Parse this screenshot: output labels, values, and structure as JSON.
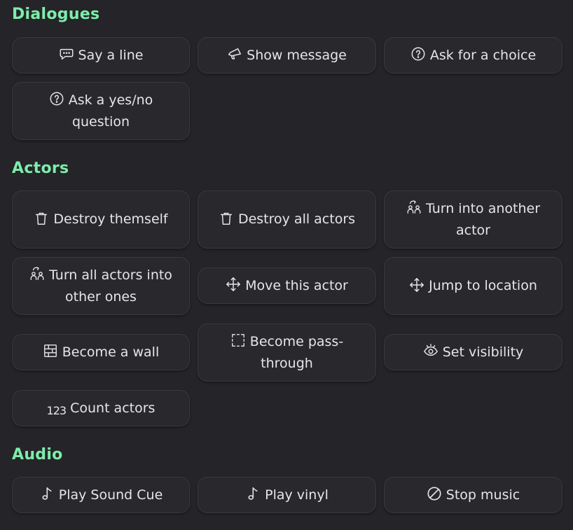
{
  "sections": {
    "dialogues": {
      "title": "Dialogues",
      "buttons": {
        "say_line": "Say a line",
        "show_message": "Show message",
        "ask_choice": "Ask for a choice",
        "ask_yes_no": "Ask a yes/no question"
      }
    },
    "actors": {
      "title": "Actors",
      "buttons": {
        "destroy_themself": "Destroy themself",
        "destroy_all_actors": "Destroy all actors",
        "turn_into_another": "Turn into another actor",
        "turn_all_actors": "Turn all actors into other ones",
        "move_this_actor": "Move this actor",
        "jump_to_location": "Jump to location",
        "become_wall": "Become a wall",
        "become_passthrough": "Become pass-through",
        "set_visibility": "Set visibility",
        "count_actors": "Count actors",
        "count_icon_text": "123"
      }
    },
    "audio": {
      "title": "Audio",
      "buttons": {
        "play_sound_cue": "Play Sound Cue",
        "play_vinyl": "Play vinyl",
        "stop_music": "Stop music"
      }
    }
  },
  "colors": {
    "accent": "#7dedab",
    "background": "#252428",
    "button_bg": "#29282d",
    "text": "#e6e5ea"
  }
}
